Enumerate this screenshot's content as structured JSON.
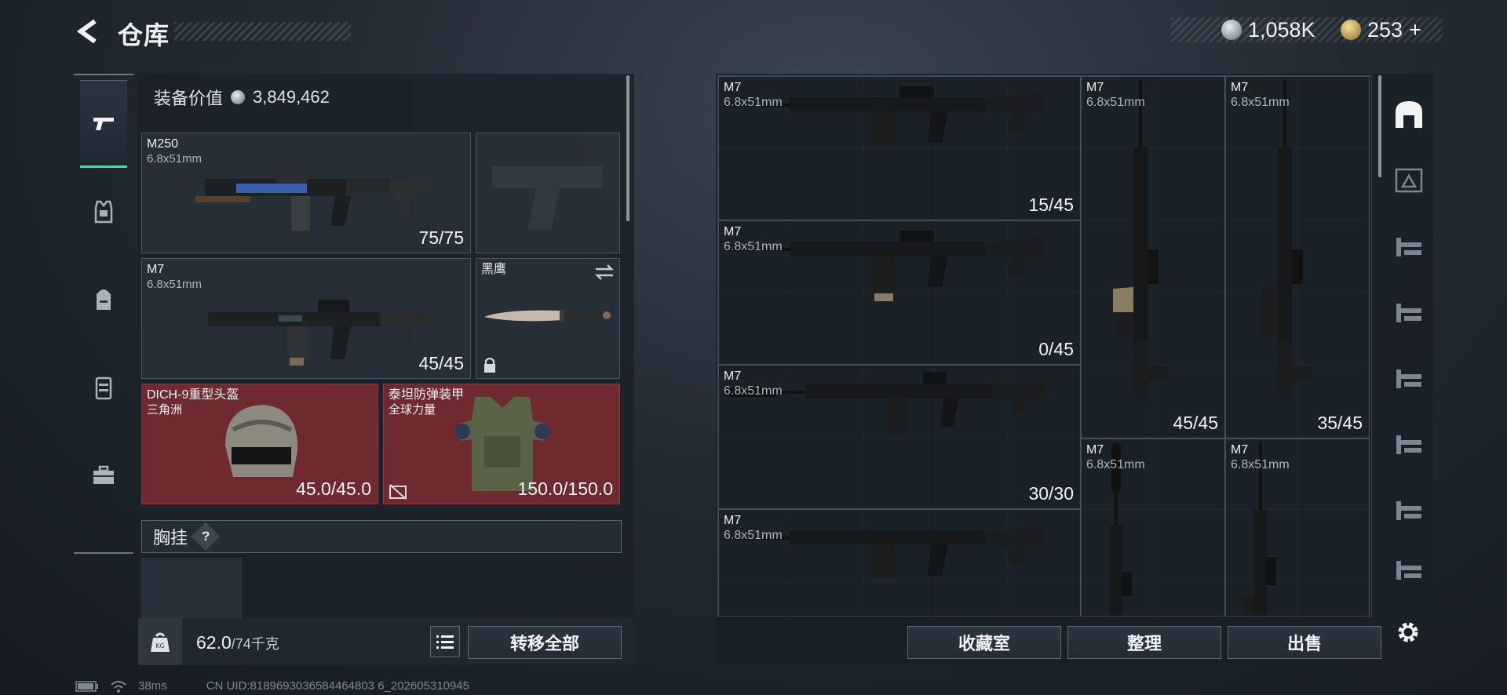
{
  "header": {
    "title": "仓库",
    "currency_silver": "1,058K",
    "currency_gold": "253",
    "currency_plus": "+"
  },
  "equipment": {
    "value_label": "装备价值",
    "value": "3,849,462",
    "primary": {
      "name": "M250",
      "caliber": "6.8x51mm",
      "ammo": "75/75"
    },
    "secondary": {
      "name": "M7",
      "caliber": "6.8x51mm",
      "ammo": "45/45"
    },
    "melee": {
      "name": "黑鹰"
    },
    "helmet": {
      "name": "DICH-9重型头盔",
      "faction": "三角洲",
      "durability": "45.0/45.0"
    },
    "armor": {
      "name": "泰坦防弹装甲",
      "faction": "全球力量",
      "durability": "150.0/150.0"
    },
    "chest_rig": {
      "label": "胸挂",
      "help": "?"
    }
  },
  "weight": {
    "current": "62.0",
    "max": "/74千克"
  },
  "buttons": {
    "transfer_all": "转移全部",
    "collection": "收藏室",
    "sort": "整理",
    "sell": "出售"
  },
  "storage": {
    "items": [
      {
        "name": "M7",
        "caliber": "6.8x51mm",
        "ammo": "15/45"
      },
      {
        "name": "M7",
        "caliber": "6.8x51mm",
        "ammo": "0/45"
      },
      {
        "name": "M7",
        "caliber": "6.8x51mm",
        "ammo": "30/30"
      },
      {
        "name": "M7",
        "caliber": "6.8x51mm",
        "ammo": ""
      },
      {
        "name": "M7",
        "caliber": "6.8x51mm",
        "ammo": "45/45"
      },
      {
        "name": "M7",
        "caliber": "6.8x51mm",
        "ammo": "35/45"
      },
      {
        "name": "M7",
        "caliber": "6.8x51mm",
        "ammo": ""
      },
      {
        "name": "M7",
        "caliber": "6.8x51mm",
        "ammo": ""
      }
    ]
  },
  "footer": {
    "ping": "38ms",
    "uid": "CN UID:8189693036584464803 6_202605310945"
  },
  "colors": {
    "accent_active": "#3ee0b0",
    "armor_slot_red": "#6e2a2f",
    "panel_bg": "#1c2229"
  }
}
